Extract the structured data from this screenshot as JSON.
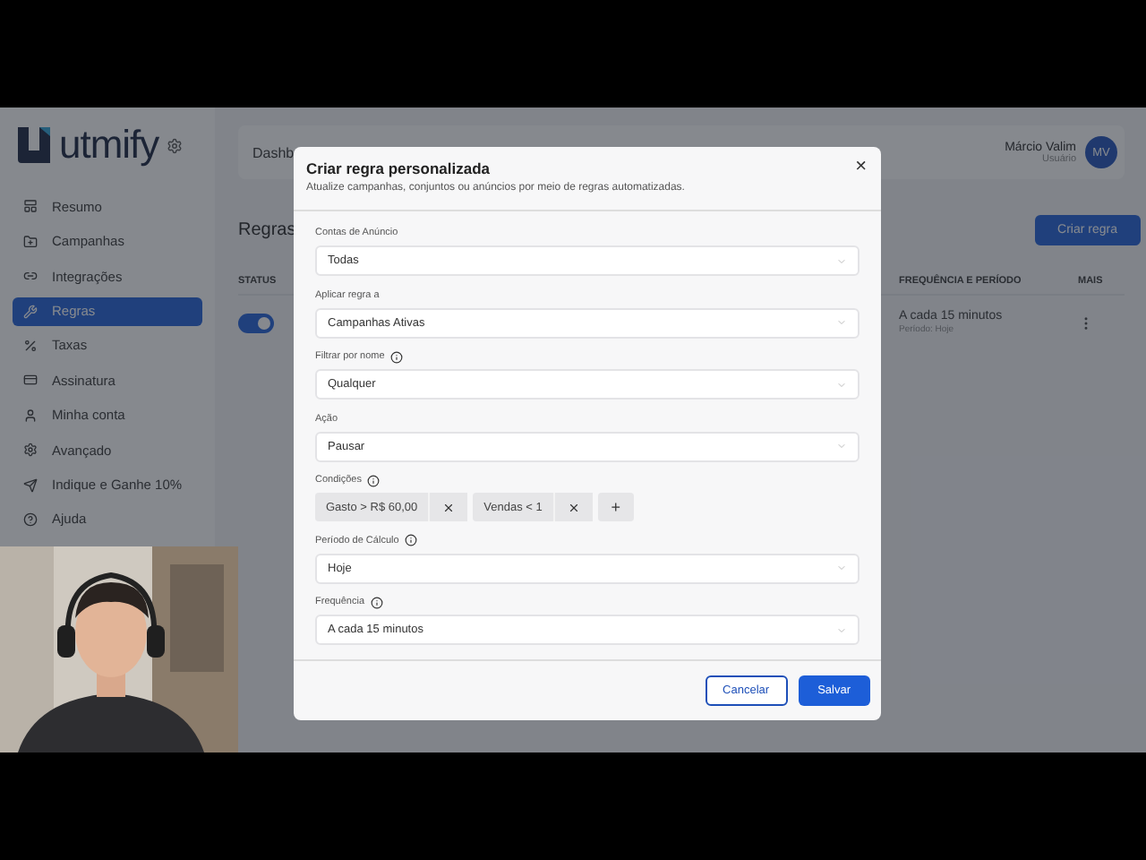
{
  "sidebar": {
    "logo": "utmify",
    "items": [
      {
        "label": "Resumo",
        "selected": false
      },
      {
        "label": "Campanhas",
        "selected": false
      },
      {
        "label": "Integrações",
        "selected": false
      },
      {
        "label": "Regras",
        "selected": true
      },
      {
        "label": "Taxas",
        "selected": false
      },
      {
        "label": "Assinatura",
        "selected": false
      },
      {
        "label": "Minha conta",
        "selected": false
      },
      {
        "label": "Avançado",
        "selected": false
      },
      {
        "label": "Indique e Ganhe 10%",
        "selected": false
      },
      {
        "label": "Ajuda",
        "selected": false
      }
    ]
  },
  "header": {
    "title": "Dashb",
    "user_name": "Márcio Valim",
    "user_role": "Usuário",
    "avatar": "MV"
  },
  "page": {
    "title": "Regras",
    "create_button": "Criar regra",
    "columns": [
      "STATUS",
      "FREQUÊNCIA E PERÍODO",
      "MAIS"
    ],
    "rows": [
      {
        "on": true,
        "frequency": "A cada 15 minutos",
        "period": "Período: Hoje"
      }
    ]
  },
  "modal": {
    "title": "Criar regra personalizada",
    "subtitle": "Atualize campanhas, conjuntos ou anúncios por meio de regras automatizadas.",
    "close": "×",
    "fields": [
      {
        "kind": "select",
        "label": "Contas de Anúncio",
        "info": false,
        "value": "Todas"
      },
      {
        "kind": "select",
        "label": "Aplicar regra a",
        "info": false,
        "value": "Campanhas Ativas"
      },
      {
        "kind": "select",
        "label": "Filtrar por nome",
        "info": true,
        "value": "Qualquer"
      },
      {
        "kind": "select",
        "label": "Ação",
        "info": false,
        "value": "Pausar"
      },
      {
        "kind": "chips",
        "label": "Condições",
        "info": true,
        "chips": [
          "Gasto > R$ 60,00",
          "Vendas < 1"
        ],
        "add": "+"
      },
      {
        "kind": "select",
        "label": "Período de Cálculo",
        "info": true,
        "value": "Hoje"
      },
      {
        "kind": "select",
        "label": "Frequência",
        "info": true,
        "value": "A cada 15 minutos"
      }
    ],
    "cancel": "Cancelar",
    "save": "Salvar"
  }
}
